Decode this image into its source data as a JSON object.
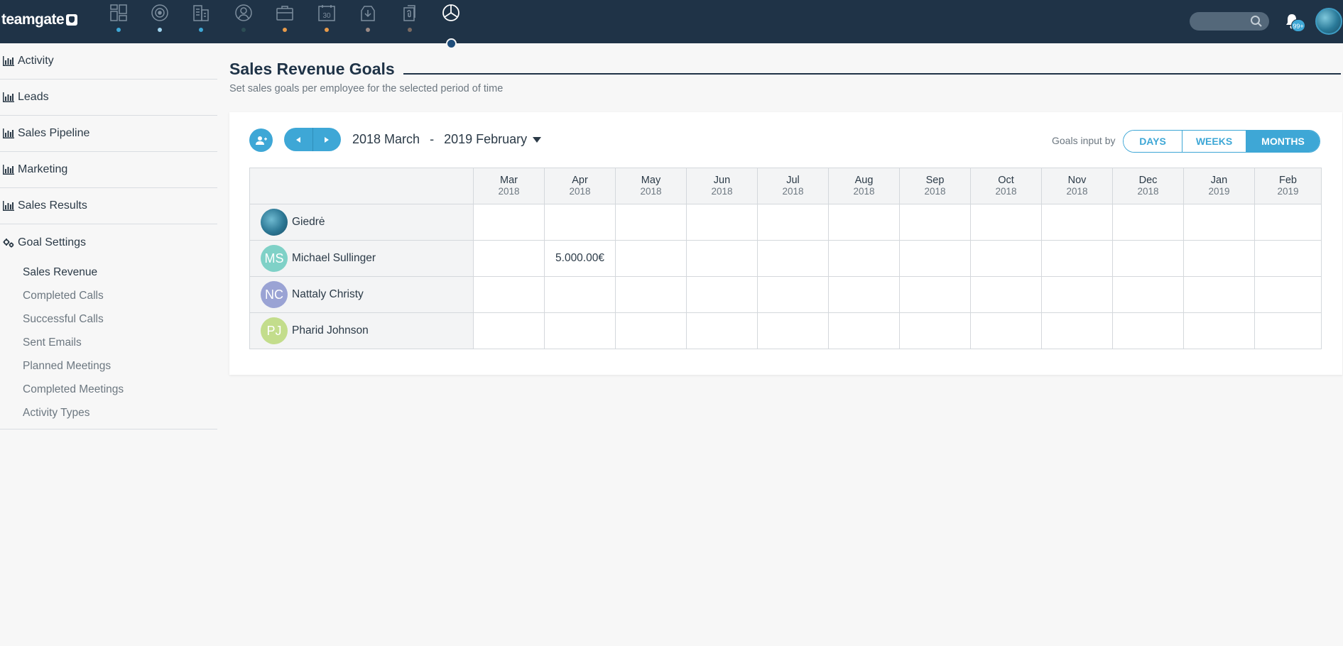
{
  "app": {
    "logo_text": "teamgate",
    "nav": [
      {
        "icon": "dashboard-icon",
        "dot": "#3ea7d6"
      },
      {
        "icon": "target-icon",
        "dot": "#9fd3ee"
      },
      {
        "icon": "companies-icon",
        "dot": "#3ea7d6"
      },
      {
        "icon": "contacts-icon",
        "dot": "#2c4d54"
      },
      {
        "icon": "deals-icon",
        "dot": "#e89b4a"
      },
      {
        "icon": "calendar-icon",
        "dot": "#e89b4a"
      },
      {
        "icon": "inbox-icon",
        "dot": "#9a8a86"
      },
      {
        "icon": "documents-icon",
        "dot": "#7a6a62"
      },
      {
        "icon": "reports-icon",
        "dot": ""
      }
    ],
    "search": {
      "placeholder": ""
    },
    "notifications_badge": "99+"
  },
  "sidebar": {
    "items": [
      {
        "label": "Activity"
      },
      {
        "label": "Leads"
      },
      {
        "label": "Sales Pipeline"
      },
      {
        "label": "Marketing"
      },
      {
        "label": "Sales Results"
      }
    ],
    "goal_settings": {
      "label": "Goal Settings",
      "subitems": [
        {
          "label": "Sales Revenue",
          "active": true
        },
        {
          "label": "Completed Calls"
        },
        {
          "label": "Successful Calls"
        },
        {
          "label": "Sent Emails"
        },
        {
          "label": "Planned Meetings"
        },
        {
          "label": "Completed Meetings"
        },
        {
          "label": "Activity Types"
        }
      ]
    }
  },
  "main": {
    "title": "Sales Revenue Goals",
    "subtitle": "Set sales goals per employee for the selected period of time",
    "period_from": "2018 March",
    "period_separator": "-",
    "period_to": "2019 February",
    "goals_input_label": "Goals input by",
    "modes": {
      "days": "DAYS",
      "weeks": "WEEKS",
      "months": "MONTHS",
      "selected": "months"
    },
    "months": [
      {
        "m": "Mar",
        "y": "2018"
      },
      {
        "m": "Apr",
        "y": "2018"
      },
      {
        "m": "May",
        "y": "2018"
      },
      {
        "m": "Jun",
        "y": "2018"
      },
      {
        "m": "Jul",
        "y": "2018"
      },
      {
        "m": "Aug",
        "y": "2018"
      },
      {
        "m": "Sep",
        "y": "2018"
      },
      {
        "m": "Oct",
        "y": "2018"
      },
      {
        "m": "Nov",
        "y": "2018"
      },
      {
        "m": "Dec",
        "y": "2018"
      },
      {
        "m": "Jan",
        "y": "2019"
      },
      {
        "m": "Feb",
        "y": "2019"
      }
    ],
    "people": [
      {
        "name": "Giedrė",
        "initials": "",
        "color": "",
        "photo": true,
        "values": [
          "",
          "",
          "",
          "",
          "",
          "",
          "",
          "",
          "",
          "",
          "",
          ""
        ]
      },
      {
        "name": "Michael Sullinger",
        "initials": "MS",
        "color": "#7fd1c7",
        "photo": false,
        "values": [
          "",
          "5.000.00€",
          "",
          "",
          "",
          "",
          "",
          "",
          "",
          "",
          "",
          ""
        ]
      },
      {
        "name": "Nattaly Christy",
        "initials": "NC",
        "color": "#9aa3d4",
        "photo": false,
        "values": [
          "",
          "",
          "",
          "",
          "",
          "",
          "",
          "",
          "",
          "",
          "",
          ""
        ]
      },
      {
        "name": "Pharid Johnson",
        "initials": "PJ",
        "color": "#c3dd8c",
        "photo": false,
        "values": [
          "",
          "",
          "",
          "",
          "",
          "",
          "",
          "",
          "",
          "",
          "",
          ""
        ]
      }
    ]
  }
}
